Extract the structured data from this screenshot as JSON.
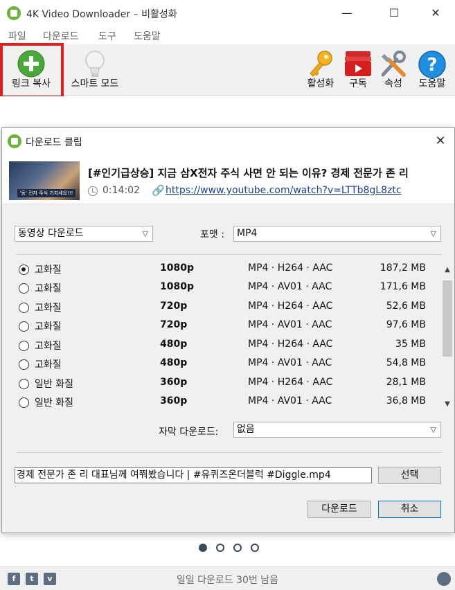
{
  "window": {
    "title": "4K Video Downloader – 비활성화",
    "minimize": "—",
    "maximize": "☐",
    "close": "✕"
  },
  "menu": [
    "파일",
    "다운로드",
    "도구",
    "도움말"
  ],
  "toolbar": {
    "paste_link": "링크 복사",
    "smart_mode": "스마트 모드",
    "activate": "활성화",
    "subscribe": "구독",
    "preferences": "속성",
    "help": "도움말"
  },
  "colors": {
    "highlight": "#e02020",
    "link": "#1a3ea0",
    "accent": "#0078d7",
    "brand_green": "#6cb23c"
  },
  "dialog": {
    "title": "다운로드 클립",
    "close": "✕",
    "video": {
      "thumb_badge": "'동' 전자 주식 가지세요!!!",
      "title": "[#인기급상승] 지금 삼X전자 주식 사면 안 되는 이유? 경제 전문가 존 리",
      "duration": "0:14:02",
      "url": "https://www.youtube.com/watch?v=LTTb8gL8ztc"
    },
    "mode_select": "동영상 다운로드",
    "format_label": "포맷 :",
    "format_select": "MP4",
    "options": [
      {
        "quality": "고화질",
        "resolution": "1080p",
        "format": "MP4 · H264 · AAC",
        "size": "187,2 MB",
        "selected": true
      },
      {
        "quality": "고화질",
        "resolution": "1080p",
        "format": "MP4 · AV01 · AAC",
        "size": "171,6 MB",
        "selected": false
      },
      {
        "quality": "고화질",
        "resolution": "720p",
        "format": "MP4 · H264 · AAC",
        "size": "52,6 MB",
        "selected": false
      },
      {
        "quality": "고화질",
        "resolution": "720p",
        "format": "MP4 · AV01 · AAC",
        "size": "97,6 MB",
        "selected": false
      },
      {
        "quality": "고화질",
        "resolution": "480p",
        "format": "MP4 · H264 · AAC",
        "size": "35 MB",
        "selected": false
      },
      {
        "quality": "고화질",
        "resolution": "480p",
        "format": "MP4 · AV01 · AAC",
        "size": "54,8 MB",
        "selected": false
      },
      {
        "quality": "일반 화질",
        "resolution": "360p",
        "format": "MP4 · H264 · AAC",
        "size": "28,1 MB",
        "selected": false
      },
      {
        "quality": "일반 화질",
        "resolution": "360p",
        "format": "MP4 · AV01 · AAC",
        "size": "36,8 MB",
        "selected": false
      }
    ],
    "subtitle_label": "자막 다운로드:",
    "subtitle_select": "없음",
    "filename": "경제 전문가 존 리 대표님께 여쭤봤습니다 | #유퀴즈온더블럭   #Diggle.mp4",
    "choose_button": "선택",
    "download_button": "다운로드",
    "cancel_button": "취소"
  },
  "status": {
    "daily_left": "일일 다운로드 30번 남음"
  },
  "icons": {
    "facebook": "facebook-icon",
    "twitter": "twitter-icon",
    "vk": "vk-icon",
    "globe": "globe-icon"
  }
}
